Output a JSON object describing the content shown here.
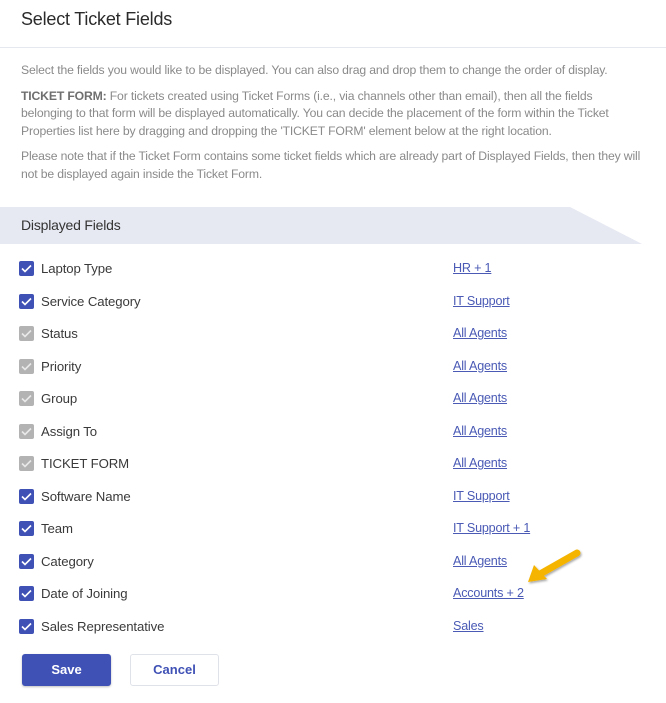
{
  "header": {
    "title": "Select Ticket Fields"
  },
  "description": {
    "intro": "Select the fields you would like to be displayed. You can also drag and drop them to change the order of display.",
    "ticket_form_label": "TICKET FORM:",
    "ticket_form_text": " For tickets created using Ticket Forms (i.e., via channels other than email), then all the fields belonging to that form will be displayed automatically. You can decide the placement of the form within the Ticket Properties list here by dragging and dropping the 'TICKET FORM' element below at the right location.",
    "note": "Please note that if the Ticket Form contains some ticket fields which are already part of Displayed Fields, then they will not be displayed again inside the Ticket Form."
  },
  "section": {
    "title": "Displayed Fields"
  },
  "fields": [
    {
      "label": "Laptop Type",
      "access": "HR + 1",
      "checked": true,
      "disabled": false
    },
    {
      "label": "Service Category",
      "access": "IT Support",
      "checked": true,
      "disabled": false
    },
    {
      "label": "Status",
      "access": "All Agents",
      "checked": true,
      "disabled": true
    },
    {
      "label": "Priority",
      "access": "All Agents",
      "checked": true,
      "disabled": true
    },
    {
      "label": "Group",
      "access": "All Agents",
      "checked": true,
      "disabled": true
    },
    {
      "label": "Assign To",
      "access": "All Agents",
      "checked": true,
      "disabled": true
    },
    {
      "label": "TICKET FORM",
      "access": "All Agents",
      "checked": true,
      "disabled": true
    },
    {
      "label": "Software Name",
      "access": "IT Support",
      "checked": true,
      "disabled": false
    },
    {
      "label": "Team",
      "access": "IT Support + 1",
      "checked": true,
      "disabled": false
    },
    {
      "label": "Category",
      "access": "All Agents",
      "checked": true,
      "disabled": false
    },
    {
      "label": "Date of Joining",
      "access": "Accounts + 2",
      "checked": true,
      "disabled": false
    },
    {
      "label": "Sales Representative",
      "access": "Sales",
      "checked": true,
      "disabled": false
    }
  ],
  "annotation": {
    "icon": "arrow-pointer-icon",
    "color": "#f5b400",
    "target": "Accounts + 2"
  },
  "buttons": {
    "save": "Save",
    "cancel": "Cancel"
  },
  "colors": {
    "accent": "#3f51b5",
    "disabled_checkbox": "#b3b3b3",
    "banner": "#e6e8f2",
    "link": "#4a5ab5"
  }
}
